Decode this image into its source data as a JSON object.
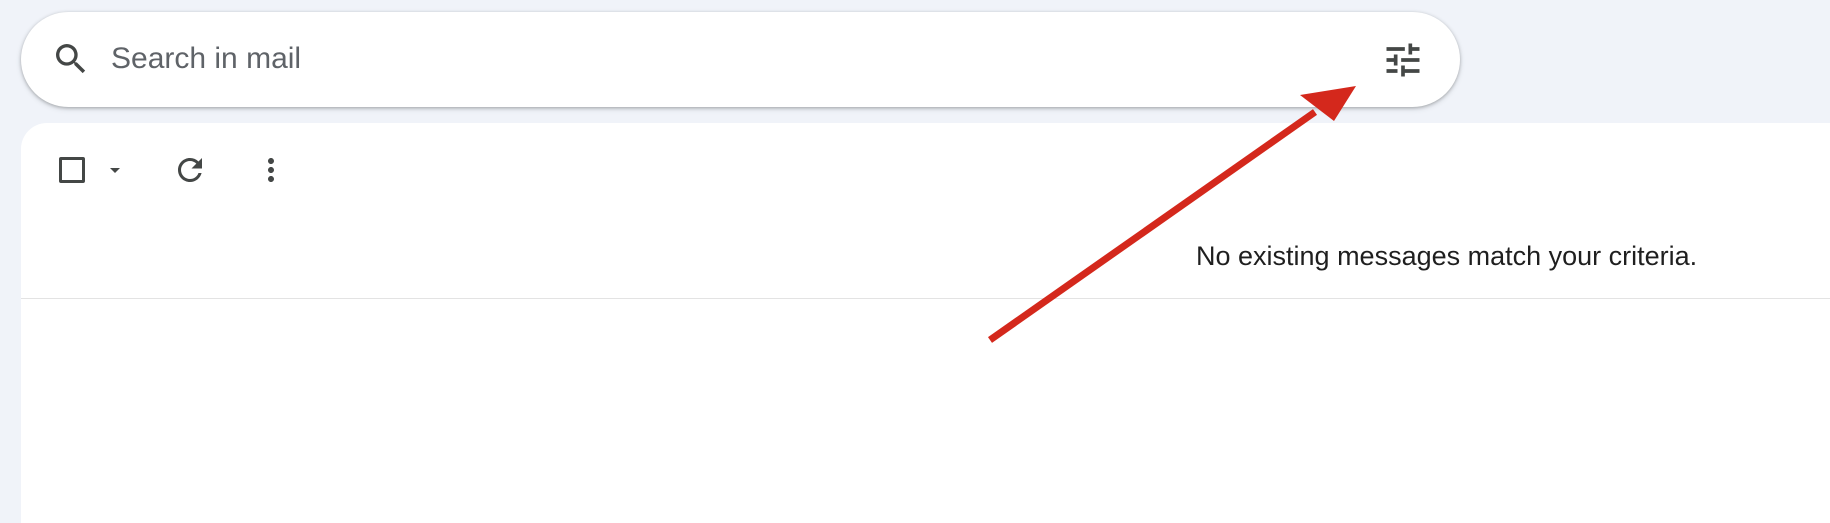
{
  "search": {
    "placeholder": "Search in mail",
    "value": "",
    "icon": "search-icon",
    "filter_icon": "tune-icon"
  },
  "toolbar": {
    "select_checkbox_icon": "checkbox-icon",
    "select_dropdown_icon": "caret-down-icon",
    "refresh_icon": "refresh-icon",
    "more_icon": "more-vert-icon"
  },
  "message_list": {
    "empty_text": "No existing messages match your criteria."
  },
  "colors": {
    "page_background": "#f0f3f9",
    "panel_background": "#ffffff",
    "icon": "#444746",
    "annotation_arrow": "#d4281c"
  }
}
